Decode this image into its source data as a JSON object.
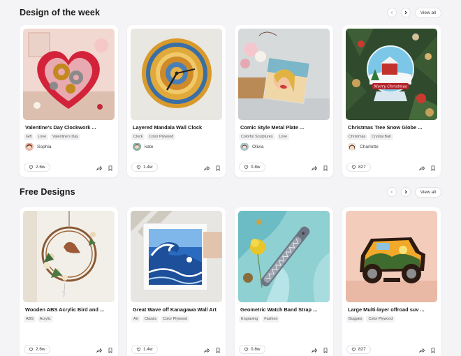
{
  "sections": [
    {
      "title": "Design of the week",
      "view_all": "View all",
      "cards": [
        {
          "title": "Valentine's Day Clockwork ...",
          "tags": [
            "Gift",
            "Love",
            "Valentine's Day"
          ],
          "author": "Sophia",
          "likes": "2.6w"
        },
        {
          "title": "Layered Mandala Wall Clock",
          "tags": [
            "Clock",
            "Color Plywood"
          ],
          "author": "kate",
          "likes": "1.4w"
        },
        {
          "title": "Comic Style Metal Plate ...",
          "tags": [
            "Colorful Sculptures",
            "Love"
          ],
          "author": "Olivia",
          "likes": "0.8w"
        },
        {
          "title": "Christmas Tree Snow Globe ...",
          "tags": [
            "Christmas",
            "Crystal Ball"
          ],
          "author": "Charlotte",
          "likes": "827"
        }
      ]
    },
    {
      "title": "Free Designs",
      "view_all": "View all",
      "cards": [
        {
          "title": "Wooden ABS Acrylic Bird and ...",
          "tags": [
            "ABS",
            "Acrylic"
          ],
          "likes": "2.6w"
        },
        {
          "title": "Great Wave off Kanagawa Wall Art",
          "tags": [
            "Art",
            "Classic",
            "Color Plywood"
          ],
          "likes": "1.4w"
        },
        {
          "title": "Geometric Watch Band Strap ...",
          "tags": [
            "Engraving",
            "Fashion"
          ],
          "likes": "0.8w"
        },
        {
          "title": "Large Multi-layer offroad suv ...",
          "tags": [
            "Buggies",
            "Color Plywood"
          ],
          "likes": "827"
        }
      ]
    }
  ],
  "snow_globe_text": "Merry Christmas"
}
